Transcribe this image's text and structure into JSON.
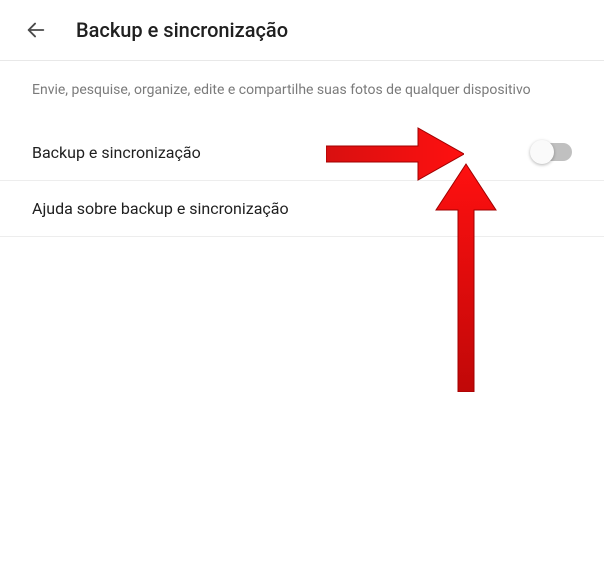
{
  "header": {
    "title": "Backup e sincronização"
  },
  "description": "Envie, pesquise, organize, edite e compartilhe suas fotos de qualquer dispositivo",
  "settings": {
    "backup_sync": {
      "label": "Backup e sincronização",
      "enabled": false
    },
    "help": {
      "label": "Ajuda sobre backup e sincronização"
    }
  }
}
